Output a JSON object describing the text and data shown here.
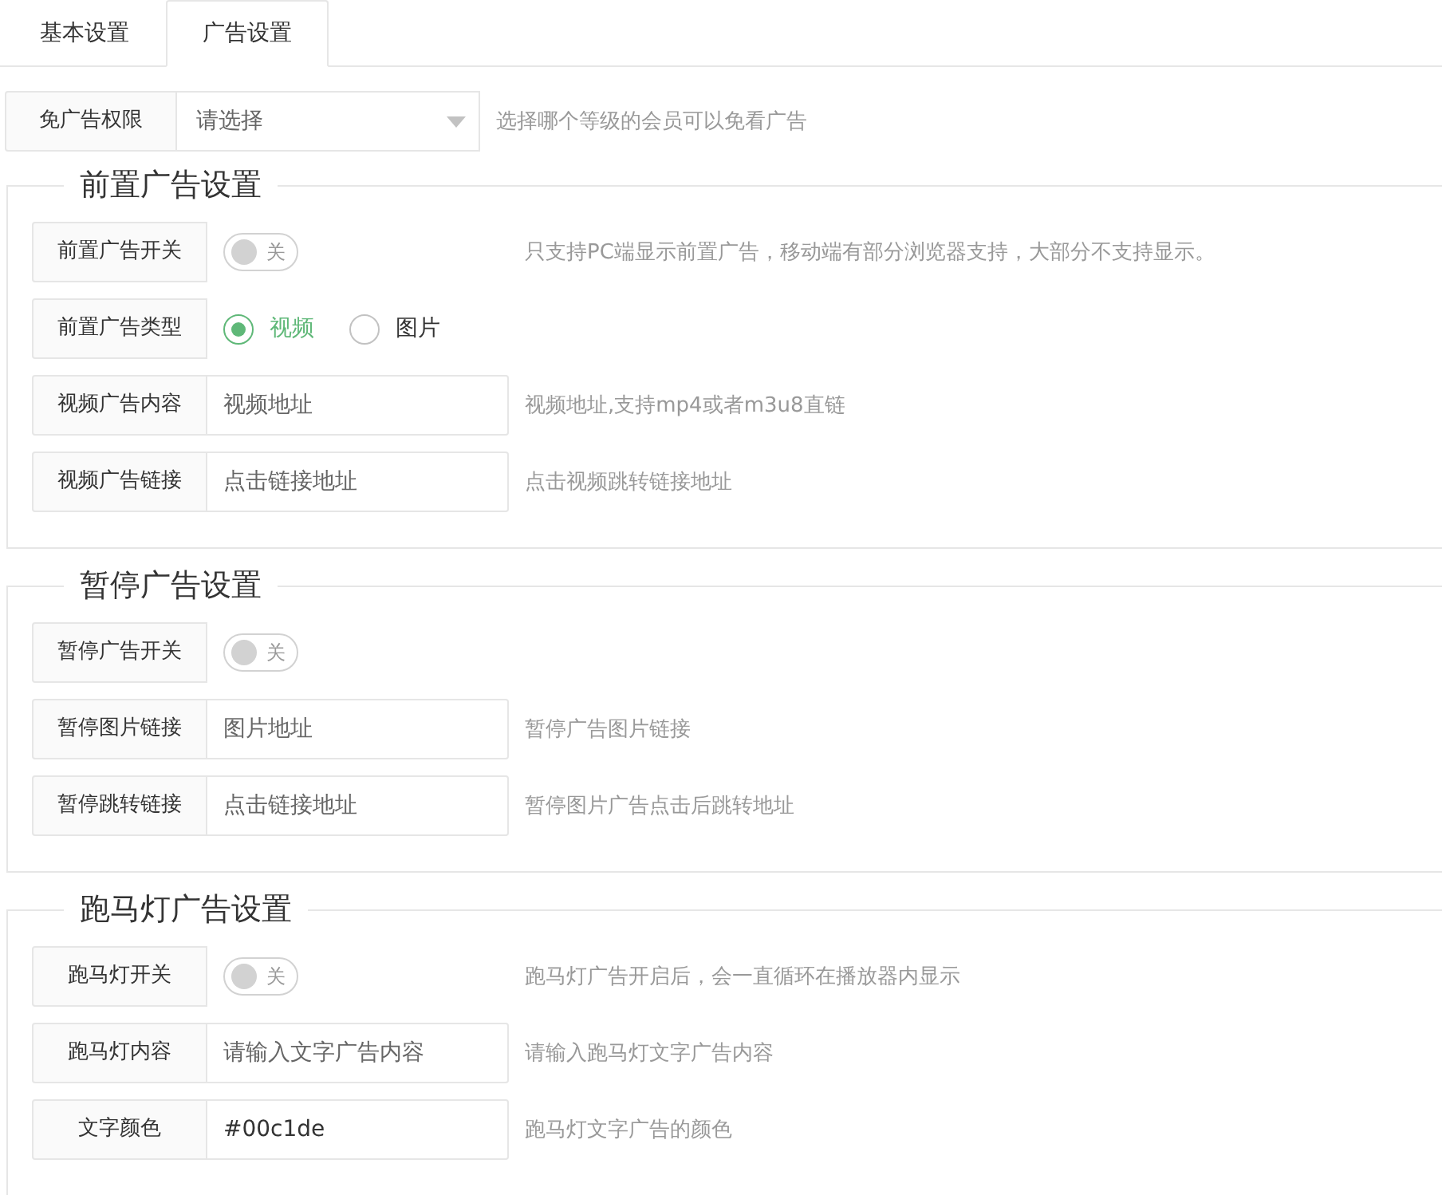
{
  "tabs": [
    {
      "label": "基本设置",
      "selected": false
    },
    {
      "label": "广告设置",
      "selected": true
    }
  ],
  "ad_free": {
    "label": "免广告权限",
    "placeholder": "请选择",
    "hint": "选择哪个等级的会员可以免看广告"
  },
  "sections": [
    {
      "title": "前置广告设置",
      "rows": [
        {
          "kind": "switch",
          "label": "前置广告开关",
          "on": false,
          "switch_text": "关",
          "hint": "只支持PC端显示前置广告，移动端有部分浏览器支持，大部分不支持显示。"
        },
        {
          "kind": "radio",
          "label": "前置广告类型",
          "options": [
            {
              "label": "视频",
              "selected": true
            },
            {
              "label": "图片",
              "selected": false
            }
          ]
        },
        {
          "kind": "input",
          "label": "视频广告内容",
          "placeholder": "视频地址",
          "hint": "视频地址,支持mp4或者m3u8直链"
        },
        {
          "kind": "input",
          "label": "视频广告链接",
          "placeholder": "点击链接地址",
          "hint": "点击视频跳转链接地址"
        }
      ]
    },
    {
      "title": "暂停广告设置",
      "rows": [
        {
          "kind": "switch",
          "label": "暂停广告开关",
          "on": false,
          "switch_text": "关"
        },
        {
          "kind": "input",
          "label": "暂停图片链接",
          "placeholder": "图片地址",
          "hint": "暂停广告图片链接"
        },
        {
          "kind": "input",
          "label": "暂停跳转链接",
          "placeholder": "点击链接地址",
          "hint": "暂停图片广告点击后跳转地址"
        }
      ]
    },
    {
      "title": "跑马灯广告设置",
      "rows": [
        {
          "kind": "switch",
          "label": "跑马灯开关",
          "on": false,
          "switch_text": "关",
          "hint": "跑马灯广告开启后，会一直循环在播放器内显示"
        },
        {
          "kind": "input",
          "label": "跑马灯内容",
          "placeholder": "请输入文字广告内容",
          "hint": "请输入跑马灯文字广告内容"
        },
        {
          "kind": "input",
          "label": "文字颜色",
          "value": "#00c1de",
          "hint": "跑马灯文字广告的颜色"
        }
      ]
    }
  ]
}
